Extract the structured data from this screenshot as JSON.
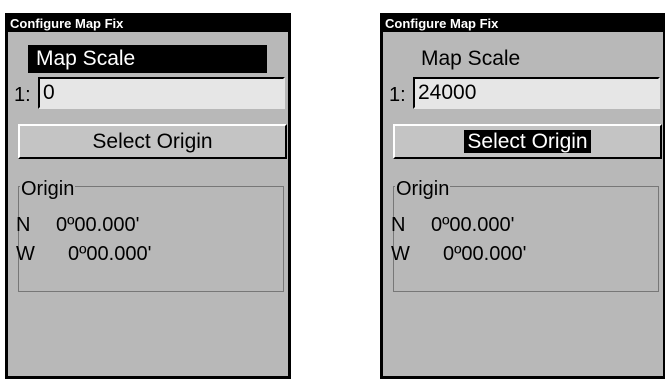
{
  "screens": [
    {
      "title": "Configure Map Fix",
      "scale_label": "Map Scale",
      "scale_prefix": "1:",
      "scale_value": "0",
      "select_origin_label": "Select Origin",
      "select_origin_highlighted": false,
      "origin_label": "Origin",
      "lat_hemi": "N",
      "lat_value": "0º00.000'",
      "lon_hemi": "W",
      "lon_value": "0º00.000'"
    },
    {
      "title": "Configure Map Fix",
      "scale_label": "Map Scale",
      "scale_prefix": "1:",
      "scale_value": "24000",
      "select_origin_label": "Select Origin",
      "select_origin_highlighted": true,
      "origin_label": "Origin",
      "lat_hemi": "N",
      "lat_value": "0º00.000'",
      "lon_hemi": "W",
      "lon_value": "0º00.000'"
    }
  ],
  "colors": {
    "screen_bg": "#b8b8b8",
    "titlebar_bg": "#000000",
    "highlight_bg": "#000000",
    "highlight_fg": "#ffffff",
    "input_bg": "#e6e6e6"
  }
}
